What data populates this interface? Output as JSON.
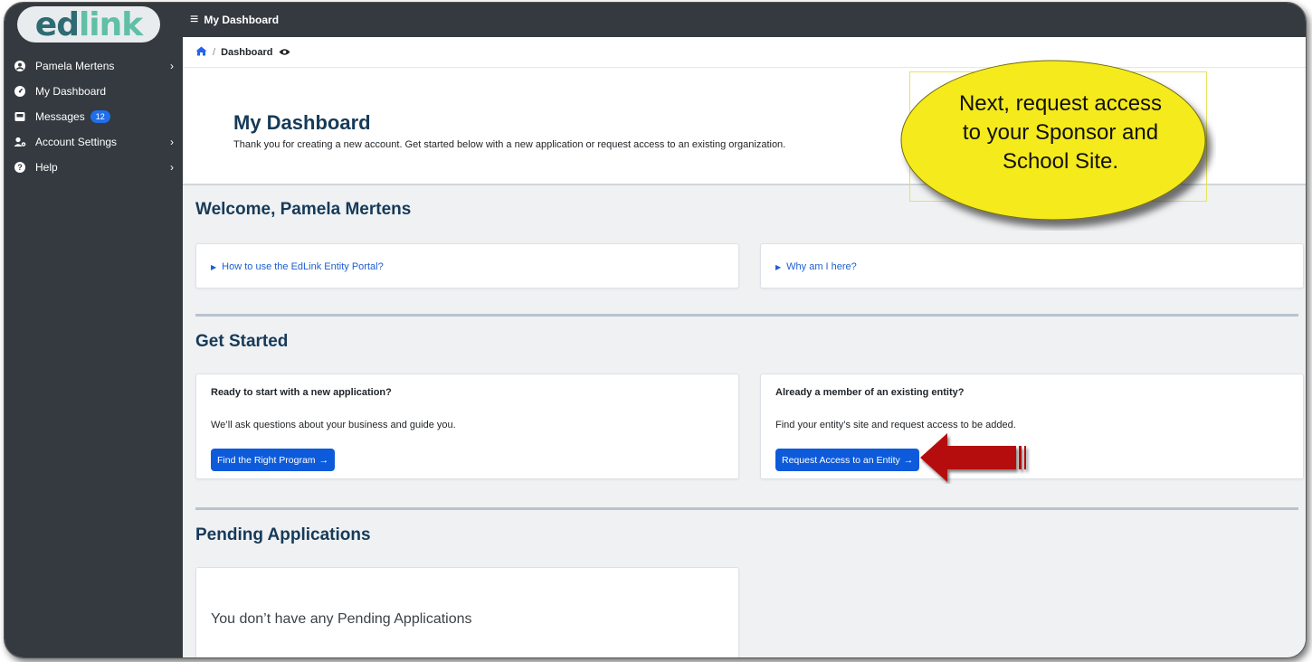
{
  "app": {
    "logo_part1": "ed",
    "logo_part2": "link",
    "logo_text": "edlink",
    "topbar_title": "My Dashboard"
  },
  "sidebar": {
    "items": [
      {
        "label": "Pamela Mertens",
        "icon": "user-circle-icon",
        "has_chevron": true
      },
      {
        "label": "My Dashboard",
        "icon": "dashboard-gauge-icon",
        "has_chevron": false
      },
      {
        "label": "Messages",
        "icon": "inbox-icon",
        "badge": "12",
        "has_chevron": false
      },
      {
        "label": "Account Settings",
        "icon": "user-cog-icon",
        "has_chevron": true
      },
      {
        "label": "Help",
        "icon": "question-circle-icon",
        "has_chevron": true
      }
    ]
  },
  "breadcrumb": {
    "current": "Dashboard",
    "separator": "/"
  },
  "header": {
    "title": "My Dashboard",
    "subtitle": "Thank you for creating a new account. Get started below with a new application or request access to an existing organization."
  },
  "welcome": {
    "title": "Welcome, Pamela Mertens",
    "link1": "How to use the EdLink Entity Portal?",
    "link2": "Why am I here?"
  },
  "get_started": {
    "title": "Get Started",
    "card1": {
      "heading": "Ready to start with a new application?",
      "text": "We’ll ask questions about your business and guide you.",
      "button": "Find the Right Program"
    },
    "card2": {
      "heading": "Already a member of an existing entity?",
      "text": "Find your entity’s site and request access to be added.",
      "button": "Request Access to an Entity"
    }
  },
  "pending": {
    "title": "Pending Applications",
    "empty_text": "You don’t have any Pending Applications"
  },
  "callout": {
    "line1": "Next, request access",
    "line2": "to your Sponsor and",
    "line3": "School Site."
  },
  "colors": {
    "sidebar_bg": "#343a40",
    "title_navy": "#163a59",
    "button_blue": "#0d5bdb",
    "link_blue": "#1e5fd0",
    "badge_blue": "#1f6feb",
    "callout_yellow": "#f5ea1e",
    "arrow_red": "#b50f0f"
  }
}
